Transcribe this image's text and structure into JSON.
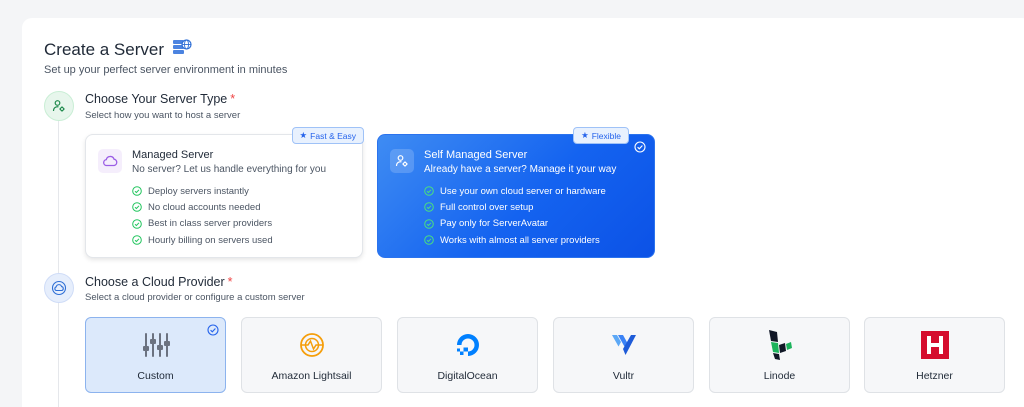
{
  "header": {
    "title": "Create a Server",
    "subtitle": "Set up your perfect server environment in minutes",
    "title_icon": "server-globe-icon"
  },
  "step1": {
    "title": "Choose Your Server Type",
    "required_mark": "*",
    "description": "Select how you want to host a server",
    "icon": "user-gear-icon",
    "options": [
      {
        "badge": "Fast & Easy",
        "title": "Managed Server",
        "subtitle": "No server? Let us handle everything for you",
        "icon": "cloud-icon",
        "selected": false,
        "features": [
          "Deploy servers instantly",
          "No cloud accounts needed",
          "Best in class server providers",
          "Hourly billing on servers used"
        ]
      },
      {
        "badge": "Flexible",
        "title": "Self Managed Server",
        "subtitle": "Already have a server? Manage it your way",
        "icon": "user-gear-icon",
        "selected": true,
        "features": [
          "Use your own cloud server or hardware",
          "Full control over setup",
          "Pay only for ServerAvatar",
          "Works with almost all server providers"
        ]
      }
    ]
  },
  "step2": {
    "title": "Choose a Cloud Provider",
    "required_mark": "*",
    "description": "Select a cloud provider or configure a custom server",
    "icon": "cloud-icon",
    "providers": [
      {
        "name": "Custom",
        "icon": "sliders-icon",
        "selected": true
      },
      {
        "name": "Amazon Lightsail",
        "icon": "lightsail-logo-icon",
        "selected": false
      },
      {
        "name": "DigitalOcean",
        "icon": "digitalocean-logo-icon",
        "selected": false
      },
      {
        "name": "Vultr",
        "icon": "vultr-logo-icon",
        "selected": false
      },
      {
        "name": "Linode",
        "icon": "linode-logo-icon",
        "selected": false
      },
      {
        "name": "Hetzner",
        "icon": "hetzner-logo-icon",
        "selected": false
      }
    ]
  },
  "colors": {
    "accent": "#1463f0",
    "success": "#22c55e",
    "required": "#ef4444",
    "lightsail": "#f59e0b",
    "digitalocean": "#0080ff",
    "vultr": "#1e6bf5",
    "linode": "#1cb35c",
    "hetzner": "#d50c2d"
  }
}
